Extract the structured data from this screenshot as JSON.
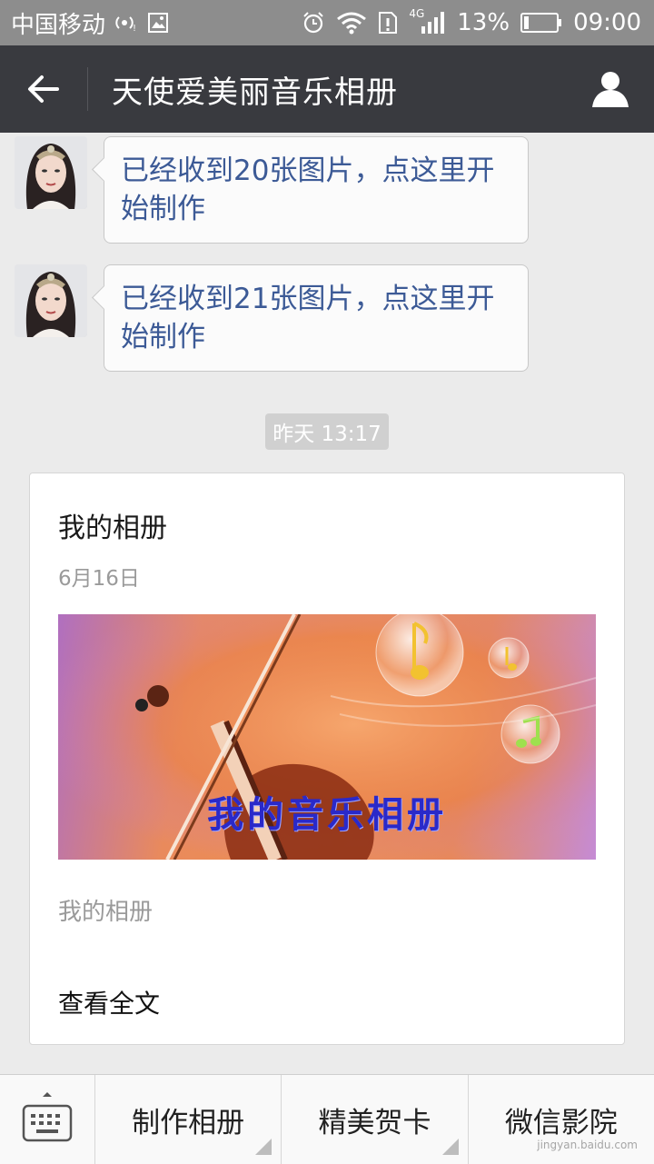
{
  "status_bar": {
    "carrier": "中国移动",
    "network": "4G",
    "battery_percent": "13%",
    "time": "09:00"
  },
  "header": {
    "title": "天使爱美丽音乐相册"
  },
  "messages": [
    {
      "text": "已经收到20张图片，点这里开始制作"
    },
    {
      "text": "已经收到21张图片，点这里开始制作"
    }
  ],
  "timestamp": "昨天 13:17",
  "article_card": {
    "title": "我的相册",
    "date": "6月16日",
    "cover_text": "我的音乐相册",
    "description": "我的相册",
    "read_more": "查看全文"
  },
  "bottom_menu": {
    "items": [
      {
        "label": "制作相册"
      },
      {
        "label": "精美贺卡"
      },
      {
        "label": "微信影院"
      }
    ]
  },
  "watermark": "jingyan.baidu.com",
  "colors": {
    "status_bar_bg": "#8d8d8d",
    "title_bar_bg": "#393a3f",
    "chat_bg": "#ebebeb",
    "link_text": "#3c5a96"
  }
}
